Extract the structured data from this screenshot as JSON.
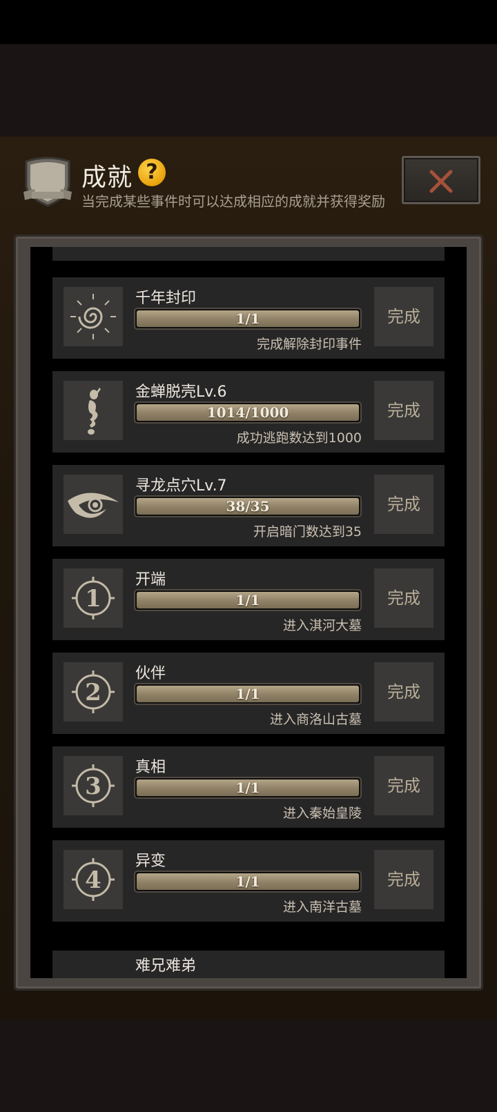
{
  "header": {
    "title": "成就",
    "help_symbol": "?",
    "subtitle": "当完成某些事件时可以达成相应的成就并获得奖励",
    "close_symbol": "×"
  },
  "achievements": [
    {
      "title": "千年封印",
      "value": "1/1",
      "progress": 1.0,
      "desc": "完成解除封印事件",
      "status": "完成",
      "icon": "seal-swirl-icon"
    },
    {
      "title": "金蝉脱壳Lv.6",
      "value": "1014/1000",
      "progress": 1.0,
      "desc": "成功逃跑数达到1000",
      "status": "完成",
      "icon": "cicada-icon"
    },
    {
      "title": "寻龙点穴Lv.7",
      "value": "38/35",
      "progress": 1.0,
      "desc": "开启暗门数达到35",
      "status": "完成",
      "icon": "eye-icon"
    },
    {
      "title": "开端",
      "value": "1/1",
      "progress": 1.0,
      "desc": "进入淇河大墓",
      "status": "完成",
      "icon": "chapter-1-icon",
      "chapter": "1"
    },
    {
      "title": "伙伴",
      "value": "1/1",
      "progress": 1.0,
      "desc": "进入商洛山古墓",
      "status": "完成",
      "icon": "chapter-2-icon",
      "chapter": "2"
    },
    {
      "title": "真相",
      "value": "1/1",
      "progress": 1.0,
      "desc": "进入秦始皇陵",
      "status": "完成",
      "icon": "chapter-3-icon",
      "chapter": "3"
    },
    {
      "title": "异变",
      "value": "1/1",
      "progress": 1.0,
      "desc": "进入南洋古墓",
      "status": "完成",
      "icon": "chapter-4-icon",
      "chapter": "4"
    }
  ],
  "partial_bottom_title": "难兄难弟"
}
